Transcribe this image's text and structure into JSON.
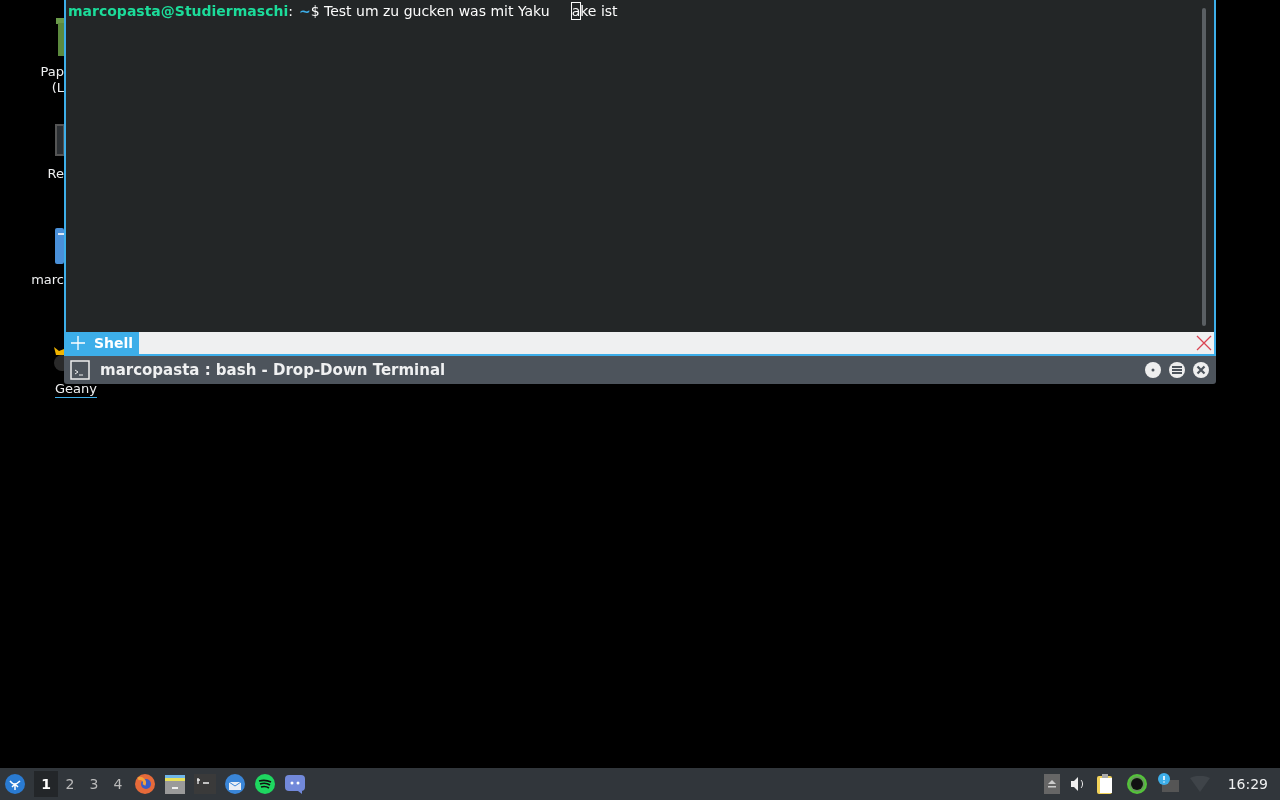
{
  "desktop_icons": [
    {
      "kind": "trash",
      "lines": [
        "Pap",
        "(L"
      ],
      "selected": false
    },
    {
      "kind": "monitor",
      "lines": [
        "Re"
      ],
      "selected": false
    },
    {
      "kind": "folder",
      "lines": [
        "marc"
      ],
      "selected": false
    },
    {
      "kind": "geany",
      "lines": [
        "Geany"
      ],
      "selected": true
    }
  ],
  "terminal": {
    "prompt": {
      "user_host": "marcopasta@Studiermaschi",
      "colon": ":",
      "path": "~",
      "symbol": "$"
    },
    "input_before_cursor": "Test um zu gucken was mit Yaku",
    "cursor_char": "a",
    "input_after_cursor": "ke ist"
  },
  "tabs": [
    {
      "label": "Shell",
      "selected": true
    }
  ],
  "window": {
    "title": "marcopasta : bash - Drop-Down Terminal"
  },
  "taskbar": {
    "workspaces": [
      {
        "label": "1",
        "selected": true
      },
      {
        "label": "2",
        "selected": false
      },
      {
        "label": "3",
        "selected": false
      },
      {
        "label": "4",
        "selected": false
      }
    ],
    "apps": [
      {
        "kind": "firefox"
      },
      {
        "kind": "files"
      },
      {
        "kind": "terminal"
      },
      {
        "kind": "mail"
      },
      {
        "kind": "spotify"
      },
      {
        "kind": "discord"
      }
    ],
    "tray": [
      {
        "kind": "eject"
      },
      {
        "kind": "volume"
      },
      {
        "kind": "clipboard"
      },
      {
        "kind": "ring"
      },
      {
        "kind": "notification"
      },
      {
        "kind": "wifi"
      }
    ],
    "clock": "16:29"
  }
}
